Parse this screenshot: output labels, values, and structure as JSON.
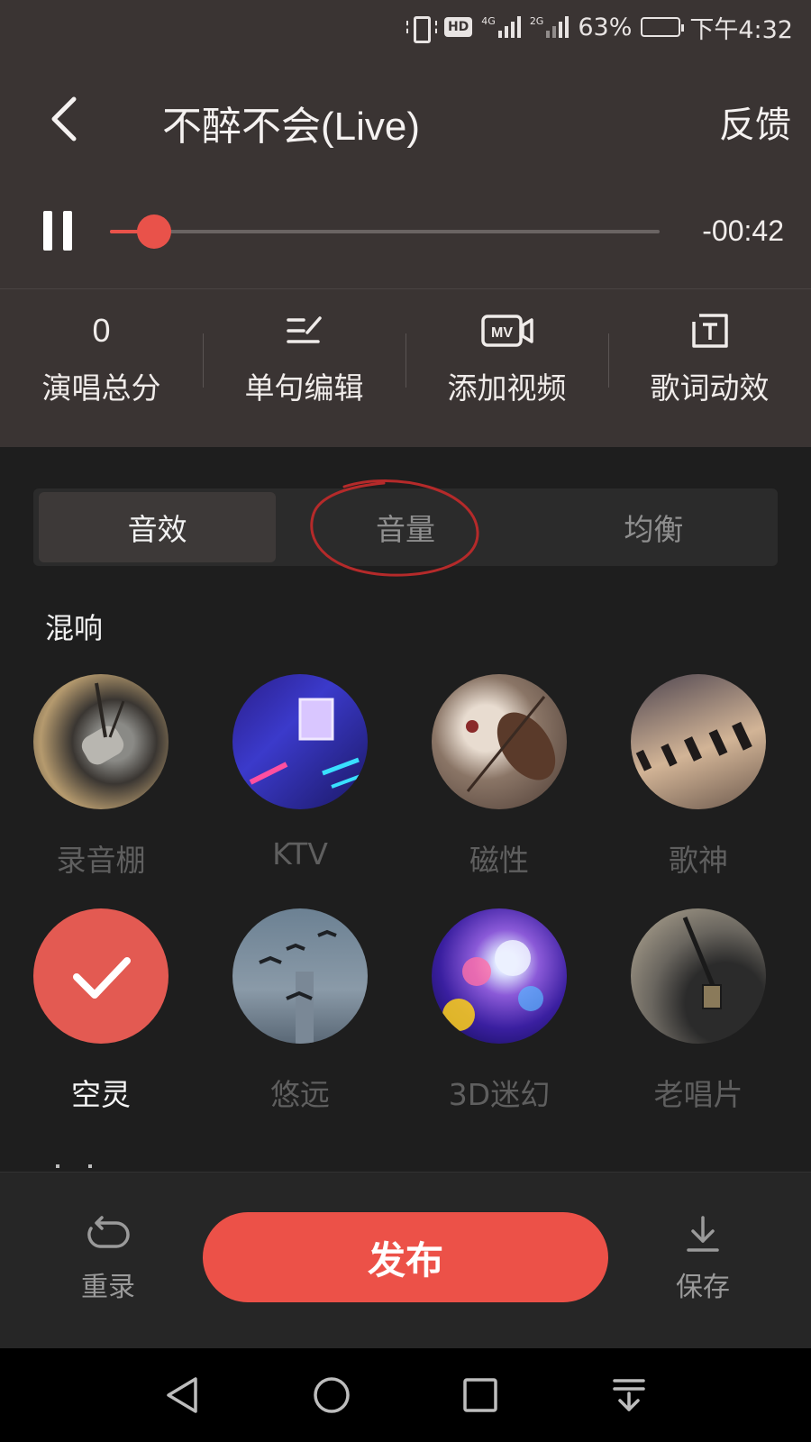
{
  "status_bar": {
    "network_4g": "4G",
    "network_2g": "2G",
    "hd": "HD",
    "battery": "63%",
    "battery_level": 0.63,
    "time": "下午4:32"
  },
  "header": {
    "title": "不醉不会(Live)",
    "feedback": "反馈"
  },
  "player": {
    "remaining": "-00:42",
    "progress": 0.08,
    "accent": "#e9524a"
  },
  "tools": [
    {
      "top": "0",
      "label": "演唱总分",
      "icon": null
    },
    {
      "top": "",
      "label": "单句编辑",
      "icon": "edit-lines-icon"
    },
    {
      "top": "",
      "label": "添加视频",
      "icon": "mv-camera-icon"
    },
    {
      "top": "",
      "label": "歌词动效",
      "icon": "lyric-text-icon"
    }
  ],
  "tabs": [
    {
      "label": "音效",
      "active": true
    },
    {
      "label": "音量",
      "active": false
    },
    {
      "label": "均衡",
      "active": false
    }
  ],
  "section": {
    "title": "混响"
  },
  "effects": [
    {
      "label": "录音棚",
      "selected": false
    },
    {
      "label": "KTV",
      "selected": false
    },
    {
      "label": "磁性",
      "selected": false
    },
    {
      "label": "歌神",
      "selected": false
    },
    {
      "label": "空灵",
      "selected": true
    },
    {
      "label": "悠远",
      "selected": false
    },
    {
      "label": "3D迷幻",
      "selected": false
    },
    {
      "label": "老唱片",
      "selected": false
    }
  ],
  "bottom": {
    "rerecord": "重录",
    "publish": "发布",
    "save": "保存"
  },
  "colors": {
    "publish": "#ec5148",
    "header_bg": "#3a3433",
    "annotation": "#b52a2a"
  }
}
